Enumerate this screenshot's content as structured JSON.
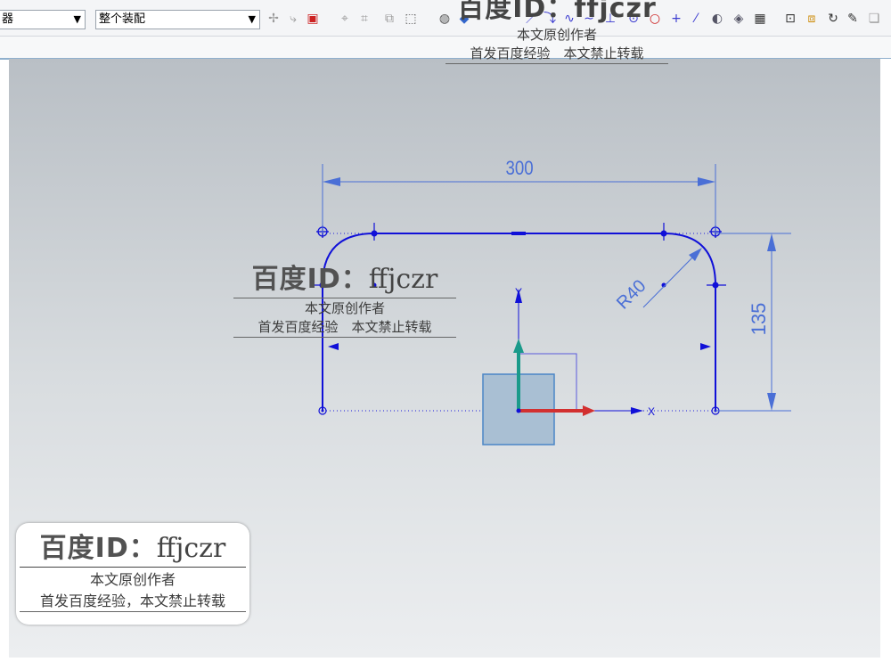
{
  "toolbar": {
    "filter_dropdown": {
      "value": "器"
    },
    "assembly_dropdown": {
      "value": "整个装配"
    },
    "icons": [
      "snap-icon",
      "curve-snap-icon",
      "select-box-icon",
      "rect-select-icon",
      "point-icon",
      "shade-icon",
      "view-icon",
      "line-icon",
      "arc-icon",
      "spline-icon",
      "tangent-icon",
      "circle-center-icon",
      "circle-icon",
      "cross-icon",
      "slash-icon",
      "render-icon",
      "material-icon",
      "grid-icon",
      "fit-icon",
      "zoom-icon",
      "rotate-icon",
      "brush-icon",
      "layer-icon"
    ]
  },
  "sketch": {
    "dim_width": "300",
    "dim_height": "135",
    "dim_radius": "R40",
    "axis_y": "Y",
    "axis_x": "X",
    "line_color": "#1a1adc"
  },
  "watermarks": {
    "top": {
      "id": "百度ID：ffjczr",
      "line1": "本文原创作者",
      "line2": "首发百度经验　本文禁止转载"
    },
    "middle": {
      "brand": "百度ID：",
      "name": "ffjczr",
      "line1": "本文原创作者",
      "line2": "首发百度经验　本文禁止转载"
    },
    "bottom": {
      "brand": "百度ID：",
      "name": "ffjczr",
      "line1": "本文原创作者",
      "line2": "首发百度经验，本文禁止转载"
    }
  }
}
